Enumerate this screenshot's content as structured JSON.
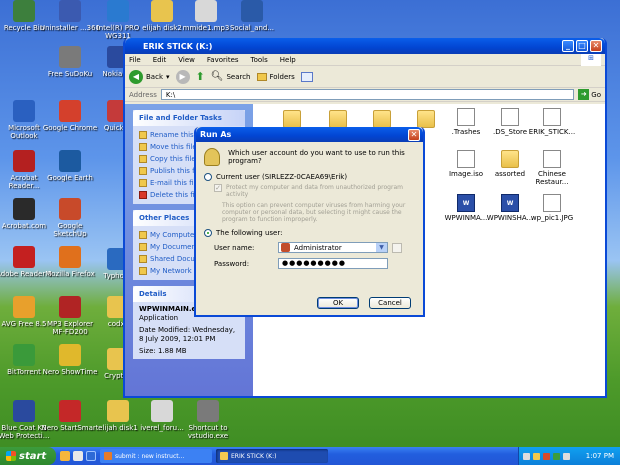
{
  "desktop_icons": [
    {
      "label": "Recycle Bin",
      "color": "#3d7f3d"
    },
    {
      "label": "Uninstaller ...360",
      "color": "#3b5ab0"
    },
    {
      "label": "Intel(R) PRO WG311",
      "color": "#2a7ad0"
    },
    {
      "label": "elijah disk2",
      "color": "#e8c44e"
    },
    {
      "label": "mmide1.mp3",
      "color": "#d8d8d8"
    },
    {
      "label": "Social_and...",
      "color": "#2a5aa8"
    },
    {
      "label": "Microsoft Outlook",
      "color": "#2a60c0"
    },
    {
      "label": "Google Chrome",
      "color": "#d4402c"
    },
    {
      "label": "Free SuDoKu",
      "color": "#7a7a7a"
    },
    {
      "label": "Nokia PC",
      "color": "#2a4a9e"
    },
    {
      "label": "Acrobat Reader...",
      "color": "#b42020"
    },
    {
      "label": "Google Earth",
      "color": "#1c5aa0"
    },
    {
      "label": "Acrobat.com",
      "color": "#2a2a2a"
    },
    {
      "label": "Google SketchUp",
      "color": "#c84a2a"
    },
    {
      "label": "Adobe Reader 9",
      "color": "#c42020"
    },
    {
      "label": "Mozilla Firefox",
      "color": "#e0701c"
    },
    {
      "label": "AVG Free 8.5",
      "color": "#e8a02c"
    },
    {
      "label": "MP3 Explorer MF-FD200",
      "color": "#b02424"
    },
    {
      "label": "BitTorrent",
      "color": "#3a9a3a"
    },
    {
      "label": "Nero ShowTime",
      "color": "#e0b82c"
    },
    {
      "label": "Blue Coat K9 Web Protecti...",
      "color": "#2a4a9e"
    },
    {
      "label": "Nero StartSmart",
      "color": "#c42828"
    },
    {
      "label": "elijah disk1",
      "color": "#e8c44e"
    },
    {
      "label": "iverel_foru...",
      "color": "#d8d8d8"
    },
    {
      "label": "Shortcut to vstudio.exe",
      "color": "#7a7a7a"
    },
    {
      "label": "Quicken",
      "color": "#c43a3a"
    },
    {
      "label": "Typhoon",
      "color": "#2a6ac0"
    },
    {
      "label": "codx_",
      "color": "#e8c44e"
    },
    {
      "label": "Cryptoa",
      "color": "#e8c44e"
    }
  ],
  "explorer": {
    "title": "ERIK STICK (K:)",
    "menu": [
      "File",
      "Edit",
      "View",
      "Favorites",
      "Tools",
      "Help"
    ],
    "toolbar": {
      "back": "Back",
      "search": "Search",
      "folders": "Folders"
    },
    "address_label": "Address",
    "address_value": "K:\\",
    "go": "Go",
    "tasks_header": "File and Folder Tasks",
    "tasks": [
      "Rename this file",
      "Move this file",
      "Copy this file",
      "Publish this file",
      "E-mail this file",
      "Delete this file"
    ],
    "other_header": "Other Places",
    "places": [
      "My Computer",
      "My Documents",
      "Shared Documents",
      "My Network Places"
    ],
    "details_header": "Details",
    "details": {
      "name": "WPWINMAIN.exe",
      "type": "Application",
      "modified": "Date Modified: Wednesday, 8 July 2009, 12:01 PM",
      "size": "Size: 1.88 MB"
    },
    "files": [
      {
        "label": "",
        "kind": "folder"
      },
      {
        "label": "",
        "kind": "folder"
      },
      {
        "label": "",
        "kind": "folder"
      },
      {
        "label": "",
        "kind": "folder"
      },
      {
        "label": ".Trashes",
        "kind": "doc"
      },
      {
        "label": ".DS_Store",
        "kind": "doc"
      },
      {
        "label": "ERIK_STICK...",
        "kind": "doc"
      },
      {
        "label": "Image.iso",
        "kind": "doc"
      },
      {
        "label": "assorted",
        "kind": "folder"
      },
      {
        "label": "Chinese Restaur...",
        "kind": "doc"
      },
      {
        "label": "WPWINMA...",
        "kind": "wpw"
      },
      {
        "label": "WPWINSHA...",
        "kind": "wpw"
      },
      {
        "label": "wp_pic1.JPG",
        "kind": "doc"
      }
    ]
  },
  "runas": {
    "title": "Run As",
    "question": "Which user account do you want to use to run this program?",
    "current_user": "Current user (SIRLEZZ-0CAEA69\\Erik)",
    "protect_label": "Protect my computer and data from unauthorized program activity",
    "protect_note": "This option can prevent computer viruses from harming your computer or personal data, but selecting it might cause the program to function improperly.",
    "following_user": "The following user:",
    "username_label": "User name:",
    "username_value": "Administrator",
    "password_label": "Password:",
    "password_value": "●●●●●●●●●",
    "ok": "OK",
    "cancel": "Cancel"
  },
  "taskbar": {
    "start": "start",
    "tasks": [
      "submit : new instruct...",
      "ERIK STICK (K:)"
    ],
    "clock": "1:07 PM"
  }
}
